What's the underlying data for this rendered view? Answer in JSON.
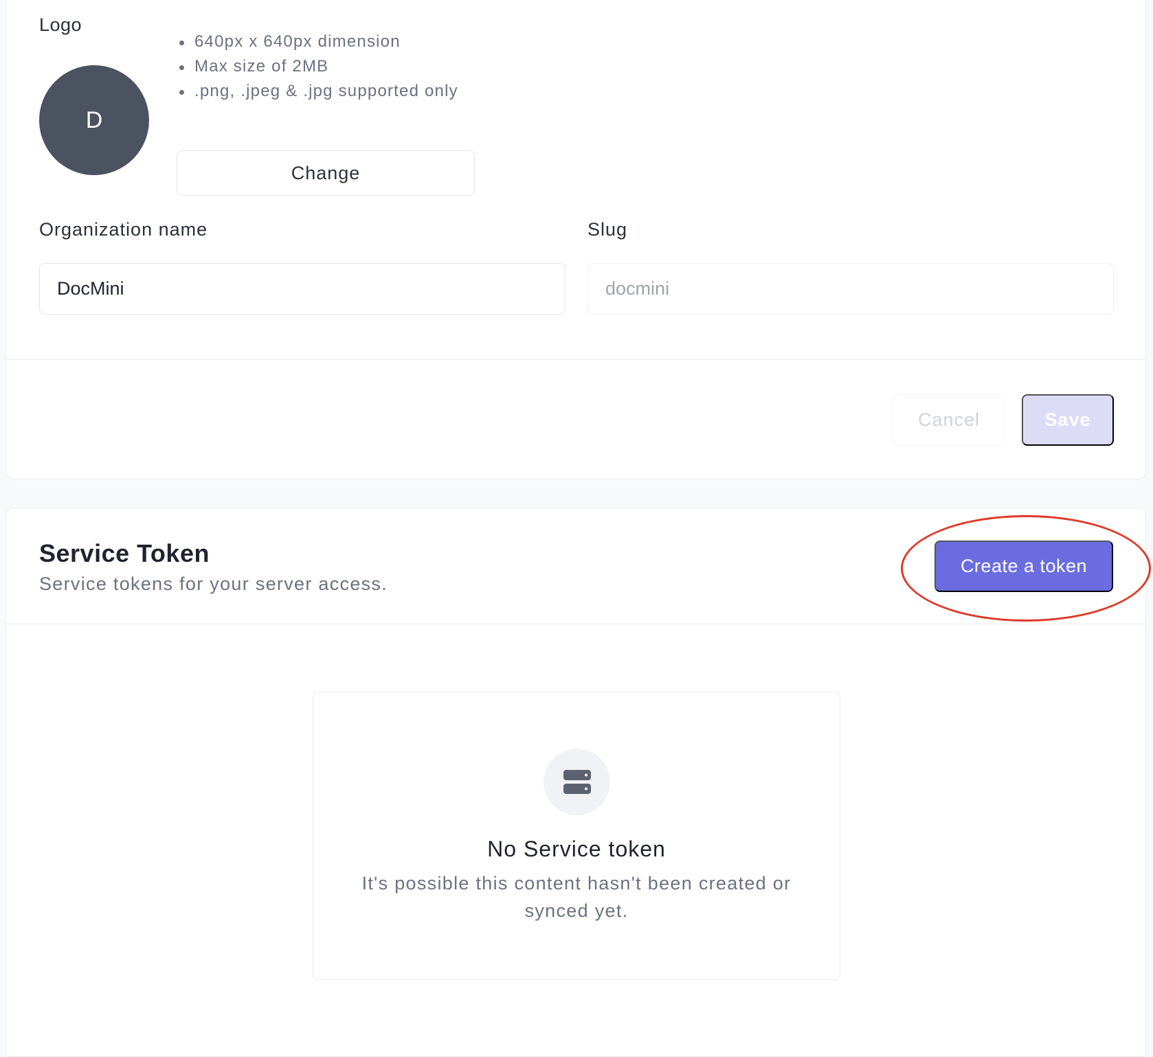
{
  "logo": {
    "label": "Logo",
    "avatar_initial": "D",
    "requirements": [
      "640px x 640px dimension",
      "Max size of 2MB",
      ".png, .jpeg & .jpg supported only"
    ],
    "change_label": "Change"
  },
  "form": {
    "org_name_label": "Organization name",
    "org_name_value": "DocMini",
    "slug_label": "Slug",
    "slug_value": "docmini"
  },
  "actions": {
    "cancel_label": "Cancel",
    "save_label": "Save"
  },
  "service_token": {
    "title": "Service Token",
    "subtitle": "Service tokens for your server access.",
    "create_label": "Create a token",
    "empty_icon": "server-icon",
    "empty_title": "No Service token",
    "empty_description": "It's possible this content hasn't been created or synced yet."
  },
  "colors": {
    "primary": "#6a6ce0",
    "primary_disabled": "#dcdcf7",
    "avatar_bg": "#4b5260",
    "highlight": "#e0392a"
  }
}
